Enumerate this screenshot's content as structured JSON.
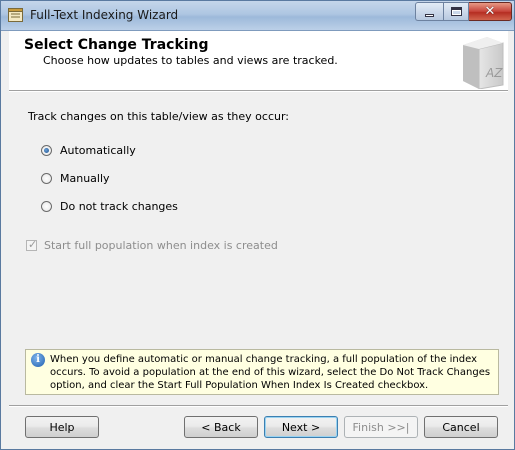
{
  "window": {
    "title": "Full-Text Indexing Wizard"
  },
  "header": {
    "title": "Select Change Tracking",
    "subtitle": "Choose how updates to tables and views are tracked."
  },
  "content": {
    "prompt": "Track changes on this table/view as they occur:",
    "options": [
      {
        "label": "Automatically",
        "checked": true
      },
      {
        "label": "Manually",
        "checked": false
      },
      {
        "label": "Do not track changes",
        "checked": false
      }
    ],
    "start_population": {
      "label": "Start full population when index is created",
      "checked": true,
      "enabled": false
    }
  },
  "info": {
    "text": "When you define automatic or manual change tracking, a full population of the index occurs. To avoid a population at the end of this wizard, select the Do Not Track Changes option, and clear the Start Full Population When Index Is Created checkbox."
  },
  "buttons": {
    "help": "Help",
    "back": "< Back",
    "next": "Next >",
    "finish": "Finish >>|",
    "cancel": "Cancel"
  },
  "icons": {
    "book_icon_text": "AZ"
  }
}
